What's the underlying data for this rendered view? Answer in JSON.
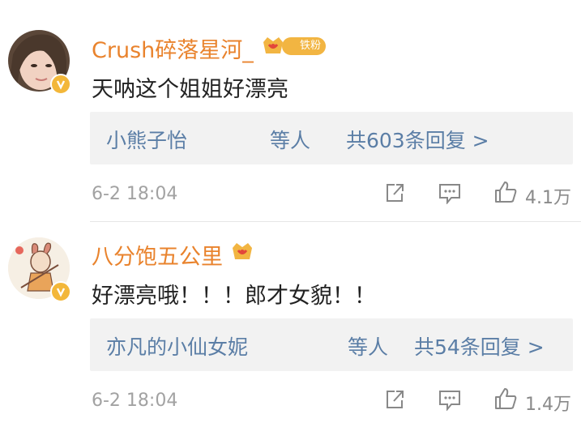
{
  "comments": [
    {
      "username": "Crush碎落星河_",
      "fan_badge": "铁粉",
      "has_crown_badge": true,
      "text": "天呐这个姐姐好漂亮",
      "replies_who": "小熊子怡",
      "replies_mid": "等人",
      "replies_count": "共603条回复 >",
      "date": "6-2 18:04",
      "likes": "4.1万",
      "icons": [
        "share-icon",
        "comment-icon",
        "thumbs-up-icon"
      ]
    },
    {
      "username": "八分饱五公里",
      "fan_badge": "",
      "has_crown_badge": true,
      "text": "好漂亮哦！！！郎才女貌！！",
      "replies_who": "亦凡的小仙女妮",
      "replies_mid": "等人",
      "replies_count": "共54条回复 >",
      "date": "6-2 18:04",
      "likes": "1.4万",
      "icons": [
        "share-icon",
        "comment-icon",
        "thumbs-up-icon"
      ]
    }
  ],
  "colors": {
    "username": "#e9832d",
    "reply_link": "#5b7ea6",
    "badge": "#f2b542",
    "meta": "#a2a2a2"
  }
}
